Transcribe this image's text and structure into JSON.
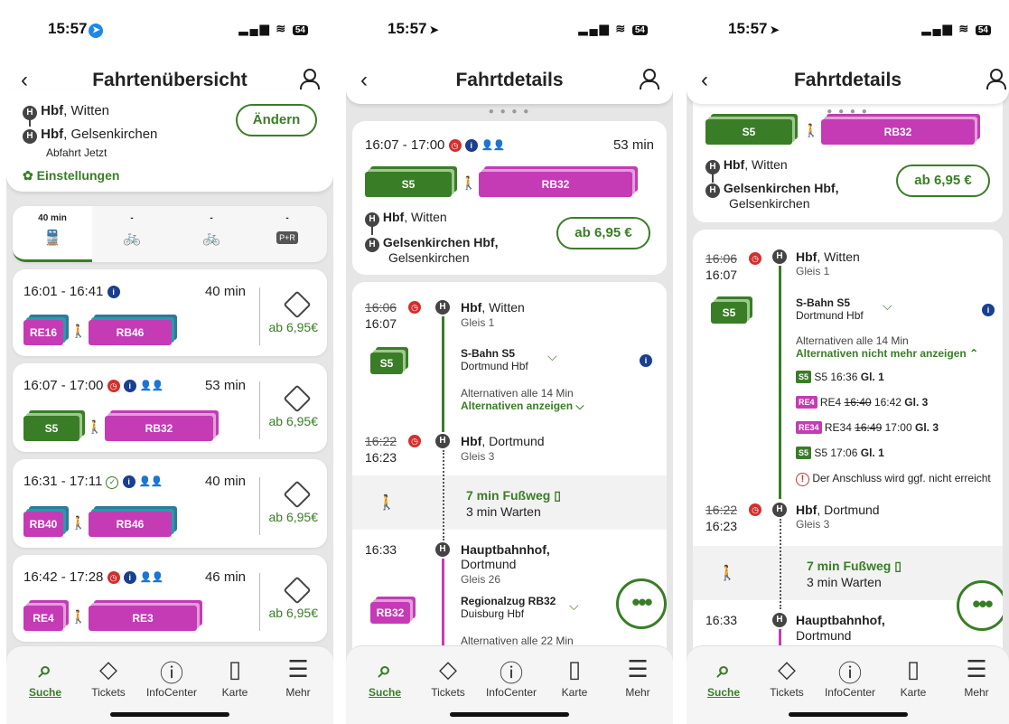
{
  "status": {
    "p1_time": "15:57",
    "p2_time": "15:57",
    "p3_time": "15:57",
    "battery": "54"
  },
  "screen1": {
    "title": "Fahrtenübersicht",
    "from_station": "Hbf",
    "from_city": ", Witten",
    "to_station": "Hbf",
    "to_city": ", Gelsenkirchen",
    "departure": "Abfahrt Jetzt",
    "change_label": "Ändern",
    "settings_label": "Einstellungen",
    "modes": [
      {
        "dur": "40 min",
        "icon": "train-bus-icon"
      },
      {
        "dur": "-",
        "icon": "bike-icon"
      },
      {
        "dur": "-",
        "icon": "bikeshare-icon"
      },
      {
        "dur": "-",
        "icon": "park-ride-icon",
        "label": "P+R"
      }
    ],
    "connections": [
      {
        "time": "16:01 - 16:41",
        "dur": "40 min",
        "price": "ab 6,95€",
        "lines": [
          "RE16",
          "RB46"
        ]
      },
      {
        "time": "16:07 - 17:00",
        "dur": "53 min",
        "price": "ab 6,95€",
        "lines": [
          "S5",
          "RB32"
        ]
      },
      {
        "time": "16:31 - 17:11",
        "dur": "40 min",
        "price": "ab 6,95€",
        "lines": [
          "RB40",
          "RB46"
        ]
      },
      {
        "time": "16:42 - 17:28",
        "dur": "46 min",
        "price": "ab 6,95€",
        "lines": [
          "RE4",
          "RE3"
        ]
      }
    ]
  },
  "screen2": {
    "title": "Fahrtdetails",
    "summary": {
      "time": "16:07 - 17:00",
      "dur": "53 min",
      "lines": [
        "S5",
        "RB32"
      ],
      "from_station": "Hbf",
      "from_city": ", Witten",
      "to_station": "Gelsenkirchen Hbf,",
      "to_city": "Gelsenkirchen",
      "price": "ab 6,95 €"
    },
    "stop1": {
      "planned": "16:06",
      "actual": "16:07",
      "station": "Hbf",
      "city": ", Witten",
      "platform": "Gleis 1",
      "line": "S5",
      "line_name": "S-Bahn S5",
      "direction": "Dortmund Hbf",
      "alt": "Alternativen alle 14 Min",
      "alt_link": "Alternativen anzeigen"
    },
    "stop2": {
      "planned": "16:22",
      "actual": "16:23",
      "station": "Hbf",
      "city": ", Dortmund",
      "platform": "Gleis 3"
    },
    "walk": {
      "label": "7 min Fußweg",
      "wait": "3 min Warten"
    },
    "stop3": {
      "time": "16:33",
      "station": "Hauptbahnhof,",
      "city": "Dortmund",
      "platform": "Gleis 26",
      "line": "RB32",
      "line_name": "Regionalzug RB32",
      "direction": "Duisburg Hbf",
      "alt": "Alternativen alle 22 Min"
    }
  },
  "screen3": {
    "title": "Fahrtdetails",
    "summary": {
      "lines": [
        "S5",
        "RB32"
      ],
      "from_station": "Hbf",
      "from_city": ", Witten",
      "to_station": "Gelsenkirchen Hbf,",
      "to_city": "Gelsenkirchen",
      "price": "ab 6,95 €"
    },
    "stop1": {
      "planned": "16:06",
      "actual": "16:07",
      "station": "Hbf",
      "city": ", Witten",
      "platform": "Gleis 1",
      "line": "S5",
      "line_name": "S-Bahn S5",
      "direction": "Dortmund Hbf",
      "alt": "Alternativen alle 14 Min",
      "alt_link": "Alternativen nicht mehr anzeigen"
    },
    "alternatives": [
      {
        "chip": "S5",
        "text": "S5 16:36",
        "extra": "",
        "platform": "Gl. 1"
      },
      {
        "chip": "RE4",
        "text": "RE4",
        "struck": "16:40",
        "extra": "16:42",
        "platform": "Gl. 3"
      },
      {
        "chip": "RE34",
        "text": "RE34",
        "struck": "16:49",
        "extra": "17:00",
        "platform": "Gl. 3"
      },
      {
        "chip": "S5",
        "text": "S5 17:06",
        "extra": "",
        "platform": "Gl. 1"
      }
    ],
    "warning": "Der Anschluss wird ggf. nicht erreicht",
    "stop2": {
      "planned": "16:22",
      "actual": "16:23",
      "station": "Hbf",
      "city": ", Dortmund",
      "platform": "Gleis 3"
    },
    "walk": {
      "label": "7 min Fußweg",
      "wait": "3 min Warten"
    },
    "stop3": {
      "time": "16:33",
      "station": "Hauptbahnhof,",
      "city": "Dortmund"
    }
  },
  "nav": [
    {
      "label": "Suche",
      "icon": "search-icon"
    },
    {
      "label": "Tickets",
      "icon": "ticket-icon"
    },
    {
      "label": "InfoCenter",
      "icon": "info-icon"
    },
    {
      "label": "Karte",
      "icon": "map-icon"
    },
    {
      "label": "Mehr",
      "icon": "menu-icon"
    }
  ],
  "colors": {
    "accent": "#3a7d27",
    "magenta": "#c43bb5",
    "delay": "#d32f2f",
    "info": "#1a3f8f"
  }
}
